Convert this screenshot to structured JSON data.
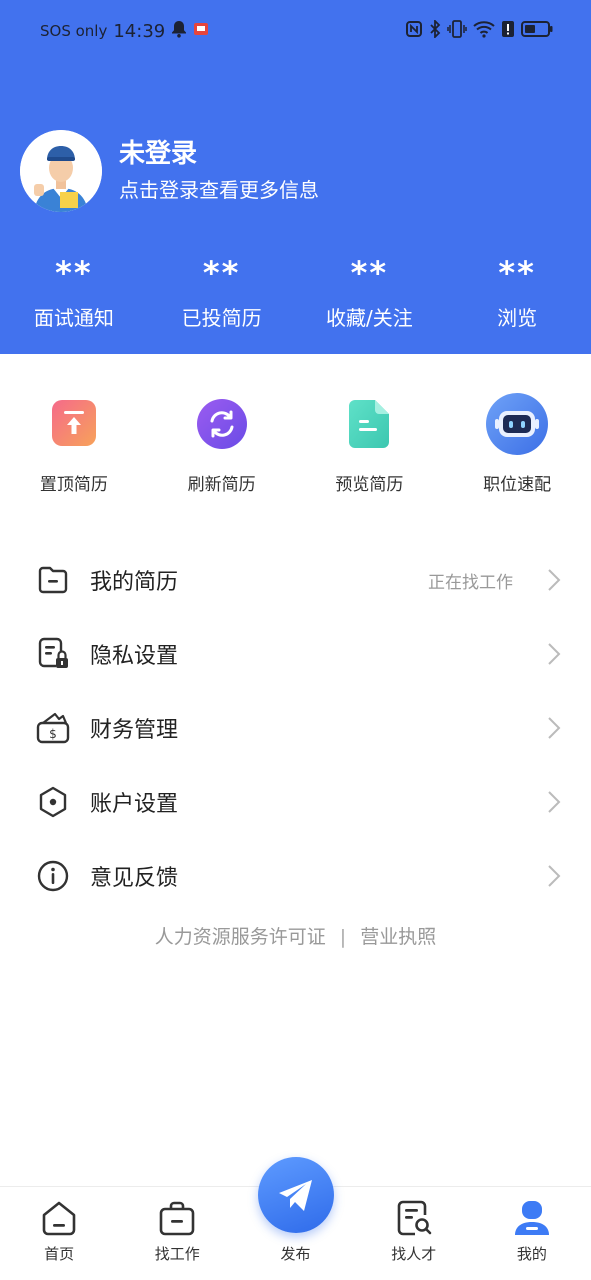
{
  "status_bar": {
    "carrier": "SOS only",
    "time": "14:39"
  },
  "profile": {
    "name": "未登录",
    "subtitle": "点击登录查看更多信息"
  },
  "stats": [
    {
      "value": "**",
      "label": "面试通知"
    },
    {
      "value": "**",
      "label": "已投简历"
    },
    {
      "value": "**",
      "label": "收藏/关注"
    },
    {
      "value": "**",
      "label": "浏览"
    }
  ],
  "quick_actions": [
    {
      "label": "置顶简历",
      "icon": "pin-top-icon"
    },
    {
      "label": "刷新简历",
      "icon": "refresh-icon"
    },
    {
      "label": "预览简历",
      "icon": "document-preview-icon"
    },
    {
      "label": "职位速配",
      "icon": "robot-match-icon"
    }
  ],
  "menu": [
    {
      "label": "我的简历",
      "value": "正在找工作",
      "icon": "folder-icon"
    },
    {
      "label": "隐私设置",
      "value": "",
      "icon": "privacy-lock-icon"
    },
    {
      "label": "财务管理",
      "value": "",
      "icon": "wallet-icon"
    },
    {
      "label": "账户设置",
      "value": "",
      "icon": "hexagon-settings-icon"
    },
    {
      "label": "意见反馈",
      "value": "",
      "icon": "info-icon"
    }
  ],
  "footer_links": {
    "license": "人力资源服务许可证",
    "separator": "|",
    "business": "营业执照"
  },
  "bottom_nav": {
    "home": "首页",
    "find_job": "找工作",
    "publish": "发布",
    "find_talent": "找人才",
    "mine": "我的"
  },
  "colors": {
    "brand_blue": "#4272EE",
    "accent_blue": "#3D7BF5"
  }
}
